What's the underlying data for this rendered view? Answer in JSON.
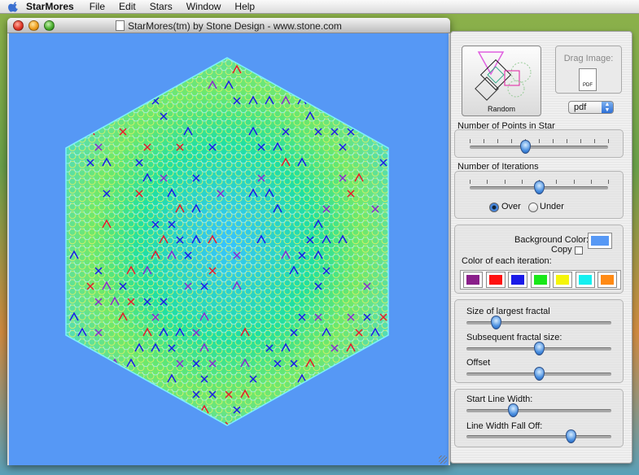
{
  "menubar": {
    "app": "StarMores",
    "items": [
      "File",
      "Edit",
      "Stars",
      "Window",
      "Help"
    ]
  },
  "window": {
    "title": "StarMores(tm) by Stone Design - www.stone.com"
  },
  "panel": {
    "random_label": "Random",
    "drag_label": "Drag Image:",
    "pdf_icon_text": "PDF",
    "format_select": {
      "value": "pdf"
    },
    "points_label": "Number of Points in Star",
    "points_value": 0.4,
    "iterations_label": "Number of Iterations",
    "iterations_value": 0.5,
    "over_label": "Over",
    "under_label": "Under",
    "mode_selected": "Over",
    "bg_label": "Background Color:",
    "bg_color": "#5698f5",
    "copy_label": "Copy",
    "iter_colors_label": "Color of each iteration:",
    "iter_colors": [
      "#8a1e8a",
      "#ff1010",
      "#1a1ae8",
      "#18e818",
      "#f5f50a",
      "#14f0f0",
      "#ff8a14"
    ],
    "largest_label": "Size of largest fractal",
    "largest_value": 0.2,
    "subsequent_label": "Subsequent fractal  size:",
    "subsequent_value": 0.5,
    "offset_label": "Offset",
    "offset_value": 0.5,
    "start_width_label": "Start Line Width:",
    "start_width_value": 0.32,
    "falloff_label": "Line Width Fall Off:",
    "falloff_value": 0.72
  }
}
